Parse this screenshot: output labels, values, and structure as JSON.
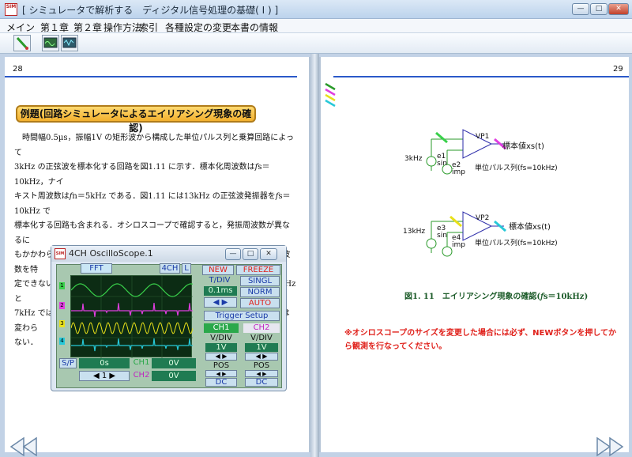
{
  "window": {
    "icon_text": "SIM",
    "title": "[ シミュレータで解析する　ディジタル信号処理の基礎( I ) ]",
    "minimize": "—",
    "maximize": "□",
    "close": "✕"
  },
  "menu": [
    "メイン",
    "第１章",
    "第２章",
    "操作方法",
    "索引",
    "各種設定の変更",
    "本書の情報"
  ],
  "left_page": {
    "page_number": "28",
    "example_title": "例題(回路シミュレータによるエイリアシング現象の確認)",
    "body": "　時間幅0.5µs，振幅1V の矩形波から構成した単位パルス列と乗算回路によって\n3kHz の正弦波を標本化する回路を図1.11 に示す．標本化周波数は𝑓s＝10kHz，ナイ\nキスト周波数は𝑓n＝5kHz である．図1.11 には13kHz の正弦波発振器を𝑓s＝10kHz で\n標本化する回路も含まれる．オシロスコープで確認すると，発振周波数が異なるに\nもかかわらず標本化器の出力は周波数ともに等しく，元のアナログ信号の周波数を特\n定できないことがわかる．尚，正弦波の周波数を変化させた場合，一見，3kHz と\n7kHz では標本化器の出力が異なるように見えるが，符号を除き標本値系列は変わら\nない．"
  },
  "oscilloscope": {
    "title": "4CH OscilloScope.1",
    "icon_text": "SIM",
    "fft_label": "FFT",
    "ch4_label": "4CH",
    "l_label": "L",
    "new_label": "NEW",
    "freeze_label": "FREEZE",
    "tdiv_label": "T/DIV",
    "tdiv_value": "0.1ms",
    "singl_label": "SINGL",
    "norm_label": "NORM",
    "auto_label": "AUTO",
    "trigger_setup_label": "Trigger Setup",
    "ch1_label": "CH1",
    "ch2_label": "CH2",
    "ch1_vdiv_label": "V/DIV",
    "ch2_vdiv_label": "V/DIV",
    "ch1_vdiv_value": "1V",
    "ch2_vdiv_value": "1V",
    "ch1_pos_label": "POS",
    "ch2_pos_label": "POS",
    "ch1_dc_label": "DC",
    "ch2_dc_label": "DC",
    "sp_label": "S/P",
    "time_value": "0s",
    "ch1_value": "0V",
    "ch2_value": "0V",
    "page_counter": "1",
    "channel_markers": [
      "1",
      "2",
      "3",
      "4"
    ],
    "colors": {
      "ch1": "#39d04a",
      "ch2": "#e03ee0",
      "ch3": "#e8e01a",
      "ch4": "#27c8d8"
    }
  },
  "right_page": {
    "page_number": "29",
    "circuit1": {
      "source_freq": "3kHz",
      "source1": "e1",
      "source1_type": "sin",
      "source2": "e2",
      "source2_type": "imp",
      "opamp": "VP1",
      "output_label": "標本値xs(t)",
      "pulse_label": "単位パルス列(fs=10kHz)"
    },
    "circuit2": {
      "source_freq": "13kHz",
      "source1": "e3",
      "source1_type": "sin",
      "source2": "e4",
      "source2_type": "imp",
      "opamp": "VP2",
      "output_label": "標本値xs(t)",
      "pulse_label": "単位パルス列(fs=10kHz)"
    },
    "caption": "図1. 11　エイリアシング現象の確認(𝑓s＝10kHz)",
    "warning": "※オシロスコープのサイズを変更した場合には必ず、NEWボタンを押してから観測を行なってください。"
  }
}
